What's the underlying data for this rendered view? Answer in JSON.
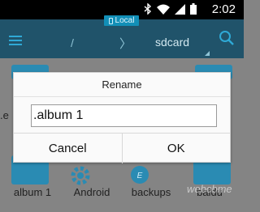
{
  "status_bar": {
    "time": "2:02",
    "icons": [
      "bluetooth-icon",
      "wifi-icon",
      "cell-signal-icon",
      "battery-icon"
    ]
  },
  "toolbar": {
    "badge_label": "Local",
    "crumb_root": "/",
    "crumb_separator": "〉",
    "crumb_current": "sdcard"
  },
  "content": {
    "partial_label": ".e",
    "items": [
      {
        "label": "album 1"
      },
      {
        "label": "Android"
      },
      {
        "label": "backups"
      },
      {
        "label": "baidu"
      }
    ],
    "watermark": "webcbme"
  },
  "dialog": {
    "title": "Rename",
    "input_value": ".album 1",
    "cancel_label": "Cancel",
    "ok_label": "OK"
  },
  "colors": {
    "toolbar": "#20536a",
    "accent": "#2fa9d6",
    "folder": "#2a8bb3",
    "overlay": "#848484"
  }
}
